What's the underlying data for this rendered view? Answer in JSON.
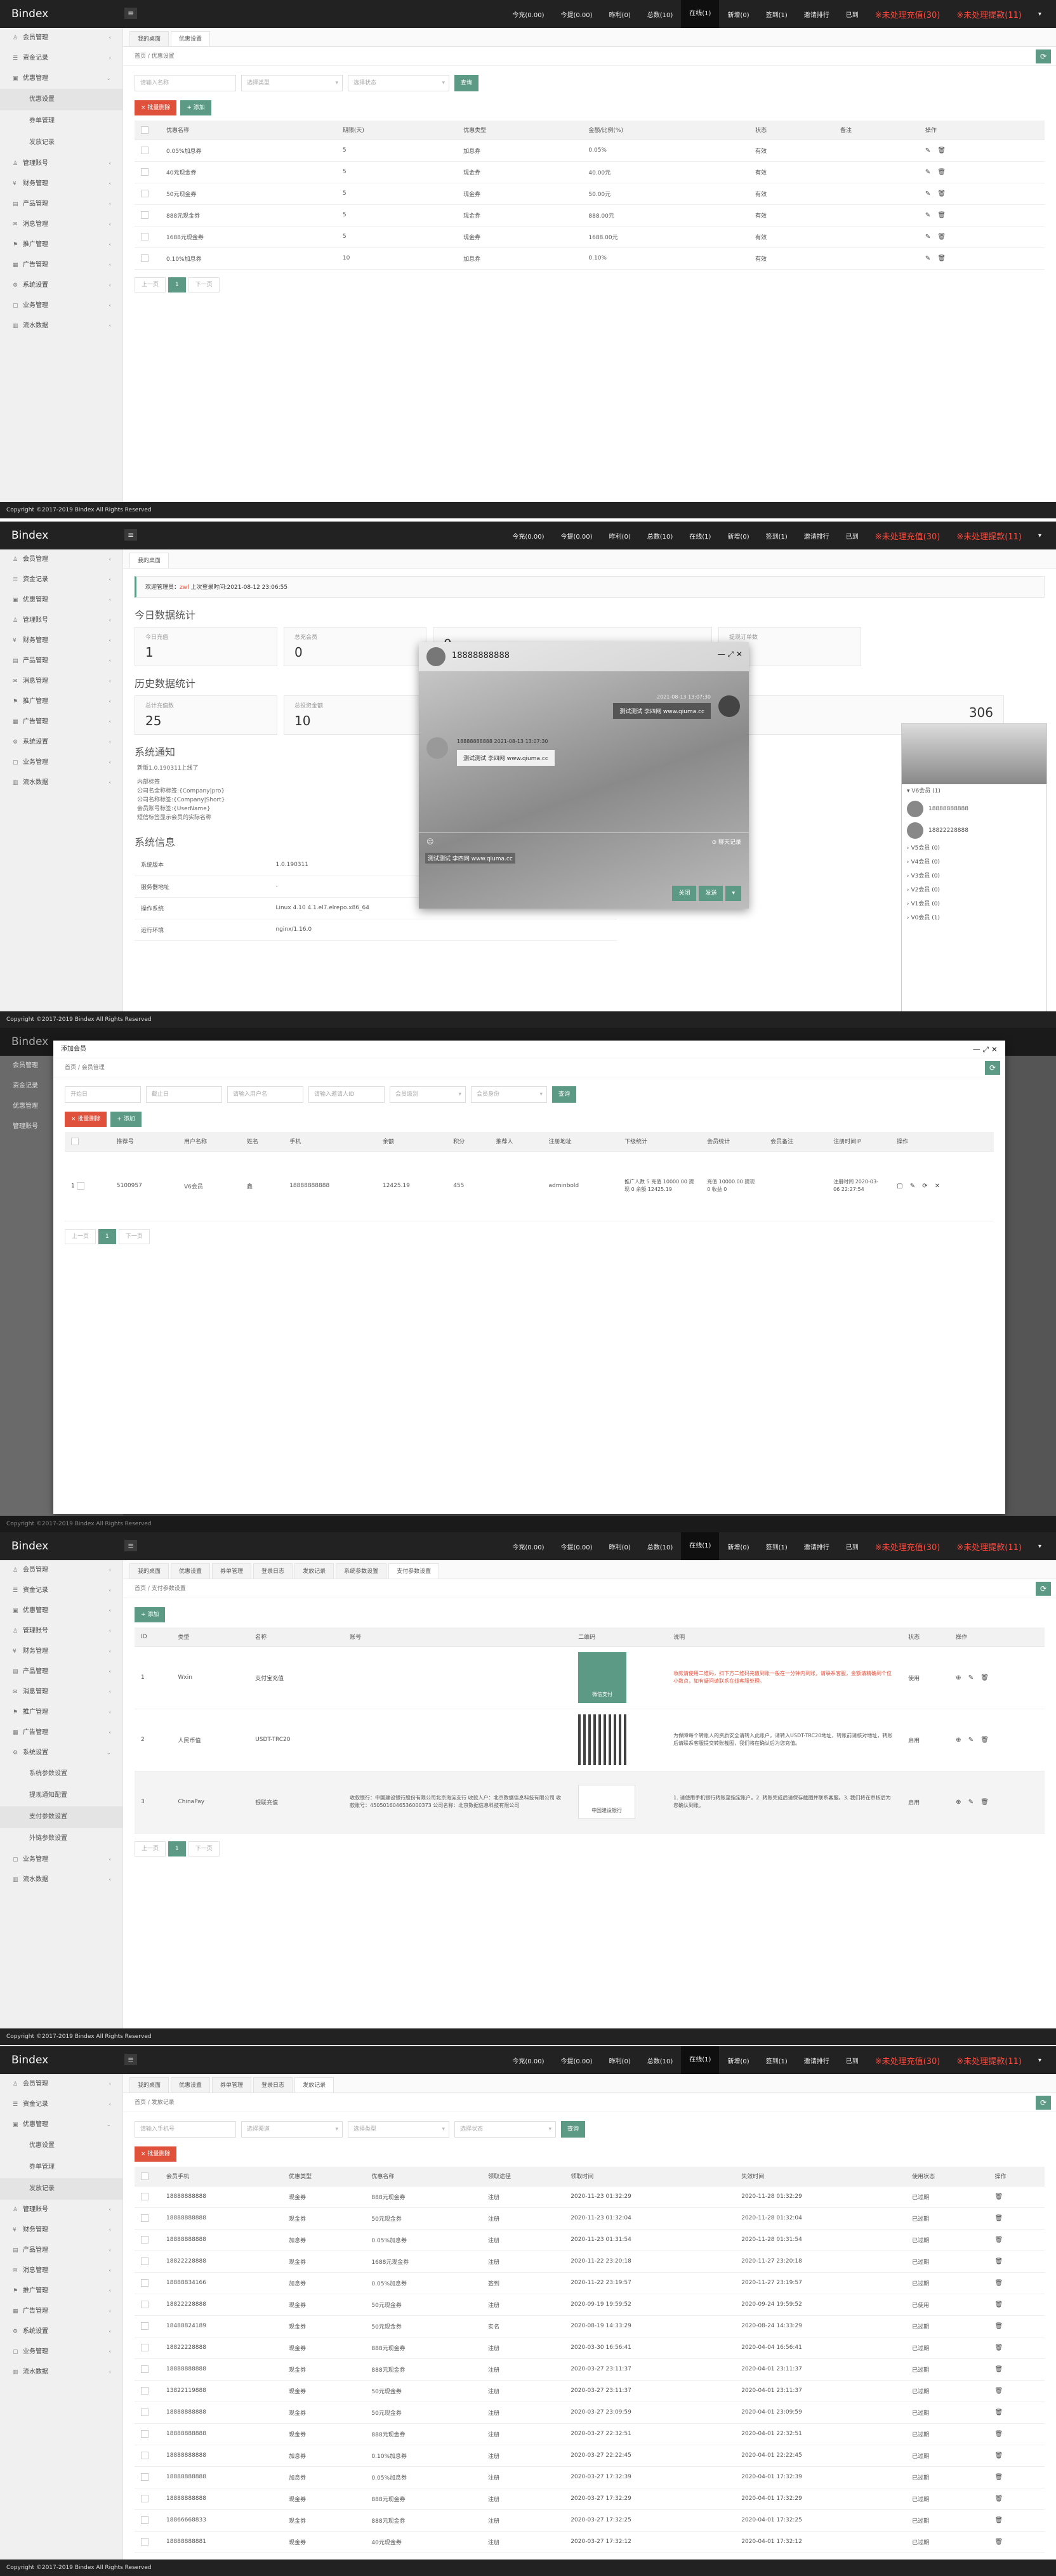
{
  "app": {
    "title": "Bindex",
    "menu_icon": "≡"
  },
  "topnav": [
    "今充(0.00)",
    "今提(0.00)",
    "昨利(0)",
    "总数(10)",
    "在线(1)",
    "新增(0)",
    "签到(1)",
    "邀请排行",
    "已到"
  ],
  "topnav_red": [
    "※未处理充值(30)",
    "※未处理提款(11)"
  ],
  "topnav_p2": [
    "今充(0.00)",
    "今提(0.00)",
    "昨利(0)",
    "总数(10)",
    "在线(1)",
    "新增(0)",
    "签到(1)",
    "邀请排行",
    "已到"
  ],
  "footer": "Copyright ©2017-2019 Bindex All Rights Reserved",
  "side": {
    "members": "会员管理",
    "stats": "资金记录",
    "coupon": "优惠管理",
    "coupon_sub": [
      "优惠设置",
      "券单管理",
      "发放记录"
    ],
    "admin": "管理账号",
    "finance": "财务管理",
    "product": "产品管理",
    "content": "消息管理",
    "promo": "推广管理",
    "ads": "广告管理",
    "system": "系统设置",
    "system_sub": [
      "系统参数设置",
      "提现通知配置",
      "支付参数设置",
      "外链参数设置"
    ],
    "orders": "业务管理",
    "data": "流水数据"
  },
  "p1": {
    "tabs": [
      "我的桌面",
      "优惠设置"
    ],
    "crumb": "首页  /  优惠设置",
    "filter_name": "请输入名称",
    "filter_type": "选择类型",
    "filter_status": "选择状态",
    "search": "查询",
    "del": "× 批量删除",
    "add": "+ 添加",
    "headers": [
      "优惠名称",
      "期限(天)",
      "优惠类型",
      "金额/比例(%)",
      "状态",
      "备注",
      "操作"
    ],
    "rows": [
      [
        "0.05%加息券",
        "5",
        "加息券",
        "0.05%",
        "有效",
        ""
      ],
      [
        "40元现金券",
        "5",
        "现金券",
        "40.00元",
        "有效",
        ""
      ],
      [
        "50元现金券",
        "5",
        "现金券",
        "50.00元",
        "有效",
        ""
      ],
      [
        "888元现金券",
        "5",
        "现金券",
        "888.00元",
        "有效",
        ""
      ],
      [
        "1688元现金券",
        "5",
        "现金券",
        "1688.00元",
        "有效",
        ""
      ],
      [
        "0.10%加息券",
        "10",
        "加息券",
        "0.10%",
        "有效",
        ""
      ]
    ],
    "prev": "上一页",
    "page": "1",
    "next": "下一页"
  },
  "p2": {
    "tabs": [
      "我的桌面"
    ],
    "welcome": "欢迎管理员：",
    "welcome_user": "zwl",
    "welcome_tail": "上次登录时间:2021-08-12 23:06:55",
    "today_title": "今日数据统计",
    "today": [
      [
        "今日充值",
        "1"
      ],
      [
        "总充会员",
        "0"
      ],
      [
        "",
        "0"
      ],
      [
        "提现订单数",
        "0"
      ]
    ],
    "hist_title": "历史数据统计",
    "hist": [
      [
        "总计充值数",
        "25"
      ],
      [
        "总投资金额",
        "10"
      ],
      [
        "",
        "306"
      ]
    ],
    "notice_title": "系统通知",
    "notice_lines": [
      "新版1.0.190311上线了",
      "内部标签",
      "公司名全称标签:{Company|pro}",
      "公司名称标签:{Company|Short}",
      "会员账号标签:{UserName}",
      "短信标签显示会员的实际名称"
    ],
    "sys_title": "系统信息",
    "sys": [
      [
        "系统版本",
        "1.0.190311"
      ],
      [
        "服务器地址",
        "-"
      ],
      [
        "操作系统",
        "Linux 4.10 4.1.el7.elrepo.x86_64"
      ],
      [
        "运行环境",
        "nginx/1.16.0"
      ]
    ],
    "chat": {
      "user": "18888888888",
      "time1": "2021-08-13 13:07:30",
      "msg1": "测试测试 李四网 www.qiuma.cc",
      "meta2": "18888888888  2021-08-13 13:07:30",
      "msg2": "测试测试 李四网 www.qiuma.cc",
      "draft": "测试测试 李四网 www.qiuma.cc",
      "history": "聊天记录",
      "close": "关闭",
      "send": "发送"
    },
    "contacts": [
      "V6会员 (1)",
      "18888888888",
      "18822228888",
      "V5会员 (0)",
      "V4会员 (0)",
      "V3会员 (0)",
      "V2会员 (0)",
      "V1会员 (0)",
      "V0会员 (1)"
    ]
  },
  "p3": {
    "modal_title": "添加会员",
    "crumb": "首页  /  会员管理",
    "filters": [
      "开始日",
      "截止日",
      "请输入用户名",
      "请输入邀请人ID",
      "会员级别",
      "会员身份"
    ],
    "search": "查询",
    "del": "× 批量删除",
    "add": "+ 添加",
    "headers": [
      "",
      "推荐号",
      "用户名称",
      "姓名",
      "手机",
      "余额",
      "积分",
      "推荐人",
      "注册地址",
      "下级统计",
      "会员统计",
      "会员备注",
      "注册时间IP",
      "操作"
    ],
    "row": [
      "1",
      "5100957",
      "V6会员",
      "鑫",
      "18888888888",
      "12425.19",
      "455",
      "",
      "adminbold",
      "推广人数 5 充值 10000.00 提现 0 余额 12425.19",
      "充值 10000.00 提现 0 收益 0",
      "",
      "注册时间 2020-03-06 22:27:54",
      "▢ ✎ ⟳ ✕"
    ],
    "prev": "上一页",
    "page": "1",
    "next": "下一页"
  },
  "p4": {
    "tabs": [
      "我的桌面",
      "优惠设置",
      "券单管理",
      "登录日志",
      "发放记录",
      "系统参数设置",
      "支付参数设置"
    ],
    "crumb": "首页  /  支付参数设置",
    "add": "+ 添加",
    "headers": [
      "ID",
      "类型",
      "名称",
      "账号",
      "二维码",
      "说明",
      "状态",
      "操作"
    ],
    "rows": [
      {
        "id": "1",
        "type": "Wxin",
        "name": "支付宝充值",
        "acct": "",
        "qr": "微信支付",
        "desc": "收款请使用二维码，扫下方二维码充值到账一般在一分钟内到账，请联系客服，金额请精确到个位小数点，如有疑问请联系在线客服处理。",
        "status": "使用"
      },
      {
        "id": "2",
        "type": "人民币值",
        "name": "USDT-TRC20",
        "acct": "",
        "qr": "",
        "desc": "为保障每个转账人的资质安全请转入此账户，请转入USDT-TRC20地址，转账前请核对地址，转账后请联系客服提交转账截图，我们将在确认后为您充值。",
        "status": "启用"
      },
      {
        "id": "3",
        "type": "ChinaPay",
        "name": "银联充值",
        "acct": "收款银行：中国建设银行股份有限公司北京海淀支行 收款人户：北京数据信息科技有限公司 收款账号：4505016046536000373 公司名称：北京数据信息科技有限公司",
        "qr": "中国建设银行",
        "desc": "1. 请使用手机银行转账至指定账户。2. 转账完成后请保存截图并联系客服。3. 我们将在审核后为您确认到账。",
        "status": "启用"
      }
    ],
    "prev": "上一页",
    "page": "1",
    "next": "下一页"
  },
  "p5": {
    "tabs": [
      "我的桌面",
      "优惠设置",
      "券单管理",
      "登录日志",
      "发放记录"
    ],
    "crumb": "首页  /  发放记录",
    "filters": [
      "请输入手机号",
      "选择渠道",
      "选择类型",
      "选择状态"
    ],
    "search": "查询",
    "del": "× 批量删除",
    "headers": [
      "会员手机",
      "优惠类型",
      "优惠名称",
      "领取途径",
      "领取时间",
      "失效时间",
      "使用状态",
      "操作"
    ],
    "rows": [
      [
        "18888888888",
        "现金券",
        "888元现金券",
        "注册",
        "2020-11-23 01:32:29",
        "2020-11-28 01:32:29",
        "已过期"
      ],
      [
        "18888888888",
        "现金券",
        "50元现金券",
        "注册",
        "2020-11-23 01:32:04",
        "2020-11-28 01:32:04",
        "已过期"
      ],
      [
        "18888888888",
        "加息券",
        "0.05%加息券",
        "注册",
        "2020-11-23 01:31:54",
        "2020-11-28 01:31:54",
        "已过期"
      ],
      [
        "18822228888",
        "现金券",
        "1688元现金券",
        "注册",
        "2020-11-22 23:20:18",
        "2020-11-27 23:20:18",
        "已过期"
      ],
      [
        "18888834166",
        "加息券",
        "0.05%加息券",
        "签到",
        "2020-11-22 23:19:57",
        "2020-11-27 23:19:57",
        "已过期"
      ],
      [
        "18822228888",
        "现金券",
        "50元现金券",
        "注册",
        "2020-09-19 19:59:52",
        "2020-09-24 19:59:52",
        "已使用"
      ],
      [
        "18488824189",
        "现金券",
        "50元现金券",
        "实名",
        "2020-08-19 14:33:29",
        "2020-08-24 14:33:29",
        "已过期"
      ],
      [
        "18822228888",
        "现金券",
        "888元现金券",
        "注册",
        "2020-03-30 16:56:41",
        "2020-04-04 16:56:41",
        "已过期"
      ],
      [
        "18888888888",
        "现金券",
        "888元现金券",
        "注册",
        "2020-03-27 23:11:37",
        "2020-04-01 23:11:37",
        "已过期"
      ],
      [
        "13822119888",
        "现金券",
        "50元现金券",
        "注册",
        "2020-03-27 23:11:37",
        "2020-04-01 23:11:37",
        "已过期"
      ],
      [
        "18888888888",
        "现金券",
        "50元现金券",
        "注册",
        "2020-03-27 23:09:59",
        "2020-04-01 23:09:59",
        "已过期"
      ],
      [
        "18888888888",
        "现金券",
        "888元现金券",
        "注册",
        "2020-03-27 22:32:51",
        "2020-04-01 22:32:51",
        "已过期"
      ],
      [
        "18888888888",
        "加息券",
        "0.10%加息券",
        "注册",
        "2020-03-27 22:22:45",
        "2020-04-01 22:22:45",
        "已过期"
      ],
      [
        "18888888888",
        "加息券",
        "0.05%加息券",
        "注册",
        "2020-03-27 17:32:39",
        "2020-04-01 17:32:39",
        "已过期"
      ],
      [
        "18888888888",
        "现金券",
        "888元现金券",
        "注册",
        "2020-03-27 17:32:29",
        "2020-04-01 17:32:29",
        "已过期"
      ],
      [
        "18866668833",
        "现金券",
        "888元现金券",
        "注册",
        "2020-03-27 17:32:25",
        "2020-04-01 17:32:25",
        "已过期"
      ],
      [
        "18888888881",
        "现金券",
        "40元现金券",
        "注册",
        "2020-03-27 17:32:12",
        "2020-04-01 17:32:12",
        "已过期"
      ]
    ]
  }
}
